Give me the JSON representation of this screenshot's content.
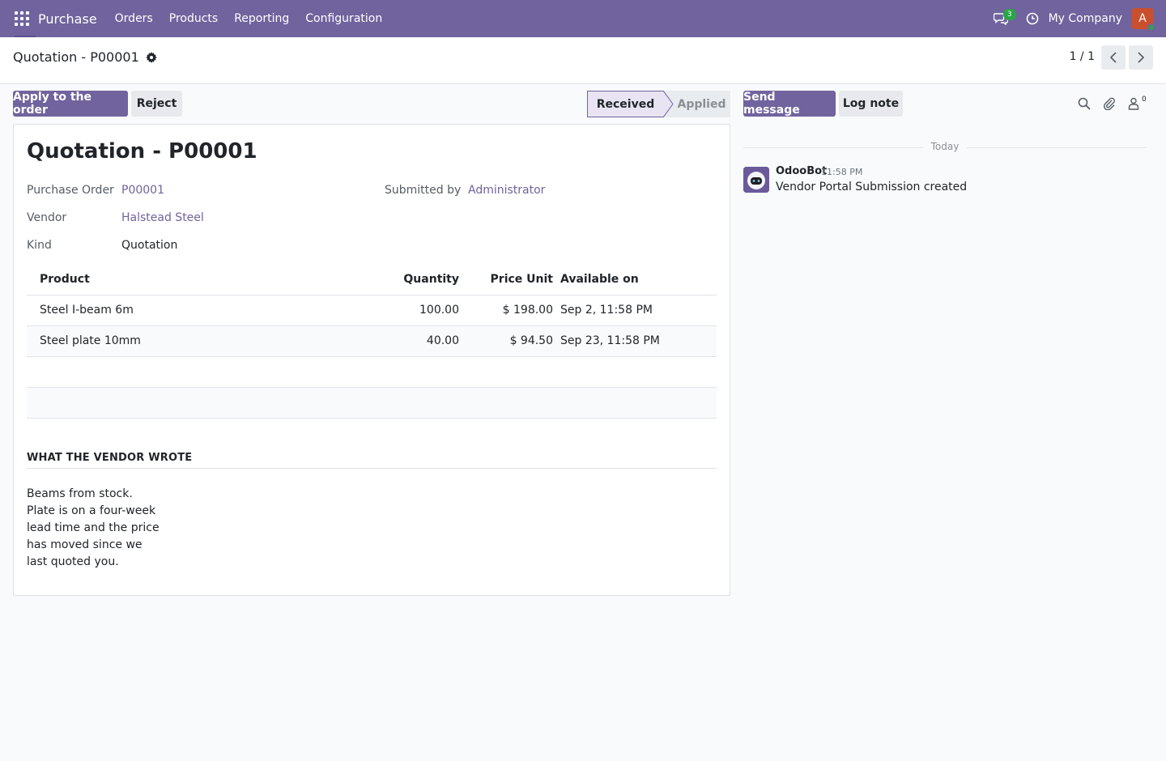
{
  "navbar": {
    "app_name": "Purchase",
    "menus": [
      "Orders",
      "Products",
      "Reporting",
      "Configuration"
    ],
    "chat_badge": "3",
    "company": "My Company",
    "avatar_initial": "A",
    "color": "#71639e"
  },
  "control": {
    "breadcrumb": "Quotation - P00001",
    "pager": "1 / 1"
  },
  "actions": {
    "apply": "Apply to the order",
    "reject": "Reject"
  },
  "status": {
    "received": "Received",
    "applied": "Applied"
  },
  "chatter": {
    "send_message": "Send message",
    "log_note": "Log note",
    "followers_count": "0",
    "day": "Today",
    "message": {
      "author": "OdooBot",
      "time": "11:58 PM",
      "body": "Vendor Portal Submission created"
    }
  },
  "form": {
    "title": "Quotation - P00001",
    "fields": {
      "purchase_order_label": "Purchase Order",
      "purchase_order_value": "P00001",
      "submitted_by_label": "Submitted by",
      "submitted_by_value": "Administrator",
      "vendor_label": "Vendor",
      "vendor_value": "Halstead Steel",
      "kind_label": "Kind",
      "kind_value": "Quotation"
    },
    "lines": {
      "headers": [
        "Product",
        "Quantity",
        "Price Unit",
        "Available on"
      ],
      "rows": [
        [
          "Steel I-beam 6m",
          "100.00",
          "$ 198.00",
          "Sep 2, 11:58 PM"
        ],
        [
          "Steel plate 10mm",
          "40.00",
          "$ 94.50",
          "Sep 23, 11:58 PM"
        ]
      ]
    },
    "section_title": "WHAT THE VENDOR WROTE",
    "vendor_note": "Beams from stock.\nPlate is on a four-week\nlead time and the price\nhas moved since we\nlast quoted you."
  }
}
